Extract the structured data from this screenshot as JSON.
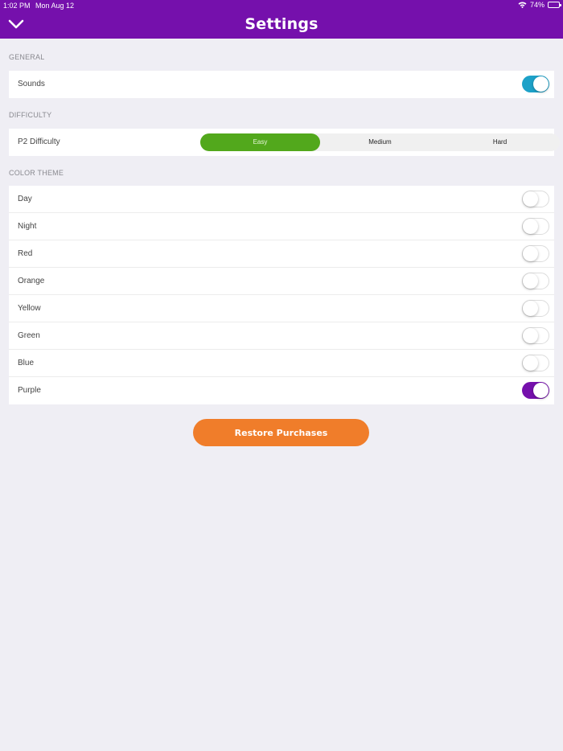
{
  "status_bar": {
    "time": "1:02 PM",
    "date": "Mon Aug 12",
    "battery": "74%",
    "battery_level": 0.74,
    "battery_color": "#6ee000"
  },
  "header": {
    "title": "Settings",
    "bg_color": "#7510ac"
  },
  "general": {
    "header": "GENERAL",
    "sounds": {
      "label": "Sounds",
      "on": true,
      "color": "#1da1c8"
    }
  },
  "difficulty": {
    "header": "DIFFICULTY",
    "p2": {
      "label": "P2 Difficulty",
      "options": [
        "Easy",
        "Medium",
        "Hard"
      ],
      "selected": "Easy",
      "active_color": "#52a81c"
    }
  },
  "color_theme": {
    "header": "COLOR THEME",
    "on_color": "#7510ac",
    "items": [
      {
        "label": "Day",
        "on": false
      },
      {
        "label": "Night",
        "on": false
      },
      {
        "label": "Red",
        "on": false
      },
      {
        "label": "Orange",
        "on": false
      },
      {
        "label": "Yellow",
        "on": false
      },
      {
        "label": "Green",
        "on": false
      },
      {
        "label": "Blue",
        "on": false
      },
      {
        "label": "Purple",
        "on": true
      }
    ]
  },
  "restore": {
    "label": "Restore Purchases",
    "color": "#f07d2a"
  }
}
